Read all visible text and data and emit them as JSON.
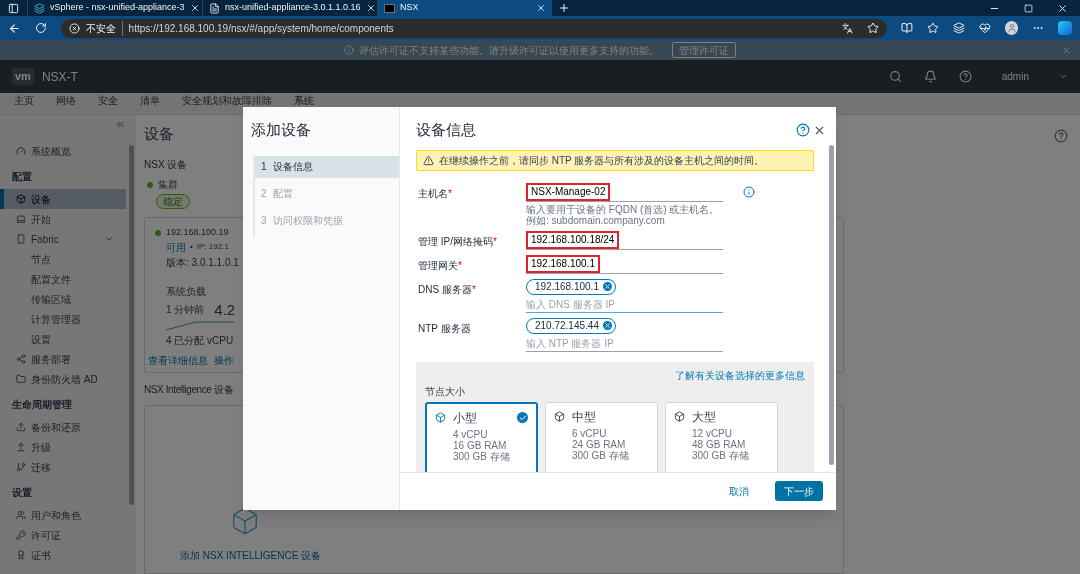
{
  "browser": {
    "tabs": [
      {
        "title": "vSphere - nsx-unified-appliance-3",
        "selected": false
      },
      {
        "title": "nsx-unified-appliance-3.0.1.1.0.16",
        "selected": false
      },
      {
        "title": "NSX",
        "selected": true
      }
    ],
    "address_bar": {
      "security": "不安全",
      "url": "https://192.168.100.19/nsx/#/app/system/home/components"
    }
  },
  "license_banner": {
    "message": "评估许可证不支持某些功能。请升级许可证以使用更多支持的功能。",
    "button": "管理许可证"
  },
  "header": {
    "logo": "vm",
    "product": "NSX-T",
    "user": "admin"
  },
  "nav": [
    {
      "label": "主页",
      "selected": false
    },
    {
      "label": "网络",
      "selected": false
    },
    {
      "label": "安全",
      "selected": false
    },
    {
      "label": "清单",
      "selected": false
    },
    {
      "label": "安全规划和故障排除",
      "selected": false
    },
    {
      "label": "系统",
      "selected": true
    }
  ],
  "sidebar": {
    "items": [
      {
        "kind": "item",
        "label": "系统概览",
        "selected": false
      },
      {
        "kind": "heading",
        "label": "配置"
      },
      {
        "kind": "item",
        "label": "设备",
        "selected": true
      },
      {
        "kind": "item",
        "label": "开始",
        "selected": false
      },
      {
        "kind": "item",
        "label": "Fabric",
        "selected": false,
        "expanded": true,
        "children": [
          {
            "label": "节点",
            "selected": false
          },
          {
            "label": "配置文件",
            "selected": false
          },
          {
            "label": "传输区域",
            "selected": false
          },
          {
            "label": "计算管理器",
            "selected": false
          },
          {
            "label": "设置",
            "selected": false
          }
        ]
      },
      {
        "kind": "item",
        "label": "服务部署",
        "selected": false
      },
      {
        "kind": "item",
        "label": "身份防火墙 AD",
        "selected": false
      },
      {
        "kind": "heading",
        "label": "生命周期管理"
      },
      {
        "kind": "item",
        "label": "备份和还原",
        "selected": false
      },
      {
        "kind": "item",
        "label": "升级",
        "selected": false
      },
      {
        "kind": "item",
        "label": "迁移",
        "selected": false
      },
      {
        "kind": "heading",
        "label": "设置"
      },
      {
        "kind": "item",
        "label": "用户和角色",
        "selected": false
      },
      {
        "kind": "item",
        "label": "许可证",
        "selected": false
      },
      {
        "kind": "item",
        "label": "证书",
        "selected": false
      }
    ]
  },
  "main": {
    "title": "设备",
    "nsx_appliances": {
      "heading": "NSX 设备",
      "cluster": {
        "label": "集群",
        "status": "稳定"
      },
      "node": {
        "ip": "192.168.100.19",
        "status": "可用",
        "separator": "•",
        "ip_detail": "IP: 192.1",
        "version": "版本: 3.0.1.1.0.1",
        "load_label": "系统负载",
        "load_time": "1 分钟前",
        "load_value": "4.2",
        "vcpu": "4 已分配 vCPU",
        "details_link": "查看详细信息",
        "actions": "操作"
      }
    },
    "intelligence": {
      "heading": "NSX Intelligence 设备",
      "add_label": "添加 NSX INTELLIGENCE 设备"
    }
  },
  "dialog": {
    "title": "添加设备",
    "steps": [
      {
        "number": "1",
        "label": "设备信息",
        "selected": true
      },
      {
        "number": "2",
        "label": "配置",
        "selected": false
      },
      {
        "number": "3",
        "label": "访问权限和凭据",
        "selected": false
      }
    ],
    "panel": {
      "title": "设备信息",
      "alert": "在继续操作之前，请同步 NTP 服务器与所有涉及的设备主机之间的时间。",
      "fields": [
        {
          "kind": "text",
          "label": "主机名",
          "required_mark": "*",
          "value": "NSX-Manage-02",
          "highlighted": true,
          "info": true,
          "helper": "输入要用于设备的 FQDN (首选) 或主机名。例如: subdomain.company.com"
        },
        {
          "kind": "text",
          "label": "管理 IP/网络掩码",
          "required_mark": "*",
          "value": "192.168.100.18/24",
          "highlighted": true,
          "info": false
        },
        {
          "kind": "text",
          "label": "管理网关",
          "required_mark": "*",
          "value": "192.168.100.1",
          "highlighted": true,
          "info": false
        },
        {
          "kind": "chips",
          "label": "DNS 服务器",
          "required_mark": "*",
          "chips": [
            "192.168.100.1"
          ],
          "placeholder": "输入 DNS 服务器 IP",
          "focused": true
        },
        {
          "kind": "chips",
          "label": "NTP 服务器",
          "chips": [
            "210.72.145.44"
          ],
          "placeholder": "输入 NTP 服务器 IP",
          "focused": false
        }
      ],
      "node_size": {
        "link": "了解有关设备选择的更多信息",
        "label": "节点大小",
        "options": [
          {
            "name": "小型",
            "specs": [
              "4 vCPU",
              "16 GB RAM",
              "300 GB 存储"
            ],
            "selected": true
          },
          {
            "name": "中型",
            "specs": [
              "6 vCPU",
              "24 GB RAM",
              "300 GB 存储"
            ],
            "selected": false
          },
          {
            "name": "大型",
            "specs": [
              "12 vCPU",
              "48 GB RAM",
              "300 GB 存储"
            ],
            "selected": false
          }
        ]
      },
      "buttons": {
        "cancel": "取消",
        "next": "下一步"
      }
    }
  }
}
